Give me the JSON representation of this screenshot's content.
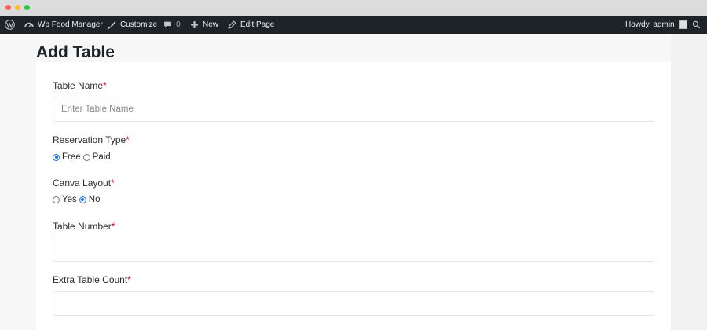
{
  "admin_bar": {
    "site_name": "Wp Food Manager",
    "customize": "Customize",
    "comments_count": "0",
    "new": "New",
    "edit_page": "Edit Page",
    "howdy": "Howdy, admin"
  },
  "page": {
    "title": "Add Table"
  },
  "form": {
    "table_name": {
      "label": "Table Name",
      "required": "*",
      "placeholder": "Enter Table Name"
    },
    "reservation_type": {
      "label": "Reservation Type",
      "required": "*",
      "options": [
        "Free",
        "Paid"
      ],
      "selected": "Free"
    },
    "canva_layout": {
      "label": "Canva Layout",
      "required": "*",
      "options": [
        "Yes",
        "No"
      ],
      "selected": "No"
    },
    "table_number": {
      "label": "Table Number",
      "required": "*",
      "value": ""
    },
    "extra_table_count": {
      "label": "Extra Table Count",
      "required": "*",
      "value": ""
    }
  },
  "colors": {
    "admin_bar_bg": "#1d2327",
    "accent_radio": "#1a73e8",
    "required_star": "#e00000"
  }
}
